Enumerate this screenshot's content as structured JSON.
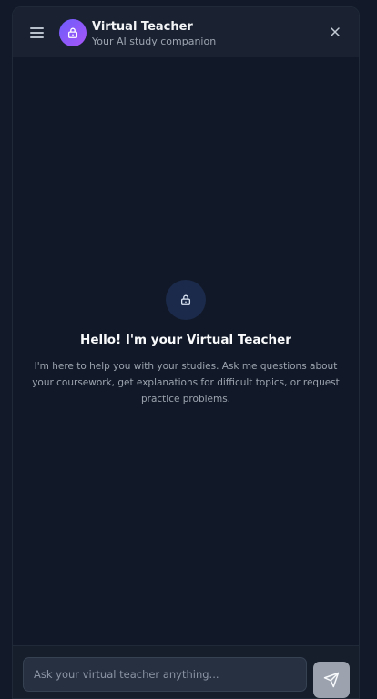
{
  "header": {
    "title": "Virtual Teacher",
    "subtitle": "Your AI study companion",
    "icons": {
      "menu": "hamburger-menu-icon",
      "avatar": "lock-icon",
      "close": "close-icon"
    }
  },
  "welcome": {
    "icon": "lock-icon",
    "title": "Hello! I'm your Virtual Teacher",
    "text": "I'm here to help you with your studies. Ask me questions about your coursework, get explanations for difficult topics, or request practice problems."
  },
  "composer": {
    "input_value": "",
    "placeholder": "Ask your virtual teacher anything...",
    "send_icon": "send-icon"
  },
  "colors": {
    "background": "#111827",
    "header": "#1a2232",
    "avatar_gradient_start": "#6d5dfc",
    "avatar_gradient_end": "#a855f7",
    "welcome_icon_bg": "#1b2a4a",
    "send_button": "#9ca3af"
  }
}
